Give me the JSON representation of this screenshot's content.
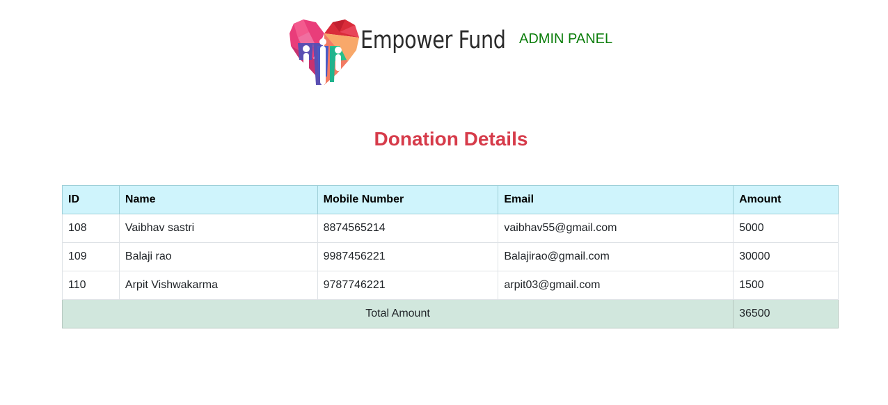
{
  "header": {
    "brand_name": "Empower Fund",
    "admin_label": "ADMIN PANEL",
    "logo_icon": "heart-people-logo-icon"
  },
  "page_title": "Donation Details",
  "table": {
    "columns": [
      "ID",
      "Name",
      "Mobile Number",
      "Email",
      "Amount"
    ],
    "rows": [
      {
        "id": "108",
        "name": "Vaibhav sastri",
        "mobile": "8874565214",
        "email": "vaibhav55@gmail.com",
        "amount": "5000"
      },
      {
        "id": "109",
        "name": "Balaji rao",
        "mobile": "9987456221",
        "email": "Balajirao@gmail.com",
        "amount": "30000"
      },
      {
        "id": "110",
        "name": "Arpit Vishwakarma",
        "mobile": "9787746221",
        "email": "arpit03@gmail.com",
        "amount": "1500"
      }
    ],
    "total_label": "Total Amount",
    "total_value": "36500"
  },
  "colors": {
    "title": "#d63b4a",
    "admin": "#0a7d0a",
    "header_row": "#cff4fc",
    "total_row": "#d1e7dd"
  }
}
